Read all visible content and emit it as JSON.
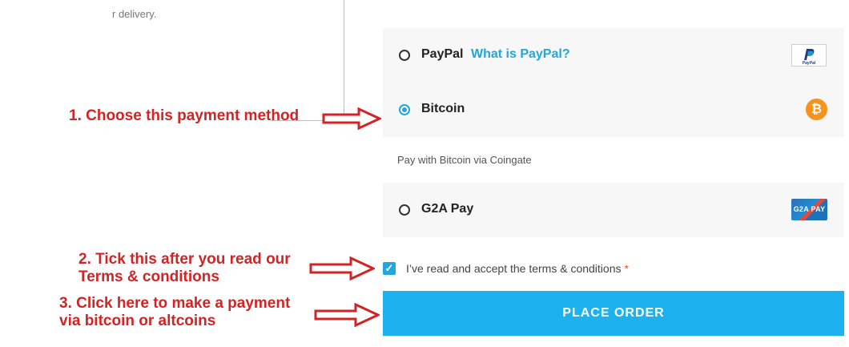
{
  "left_text": "r delivery.",
  "payment_methods": [
    {
      "label": "PayPal",
      "link": "What is PayPal?",
      "logo_text": "PayPal",
      "selected": false
    },
    {
      "label": "Bitcoin",
      "logo_text": "₿",
      "selected": true
    },
    {
      "label": "G2A Pay",
      "logo_text": "G2A PAY",
      "selected": false
    }
  ],
  "bitcoin_description": "Pay with Bitcoin via Coingate",
  "terms": {
    "text": "I’ve read and accept the terms & conditions",
    "required_mark": "*",
    "checked": true
  },
  "place_order_label": "PLACE ORDER",
  "annotations": {
    "step1": "1. Choose this payment method",
    "step2_line1": "2. Tick this after you read our",
    "step2_line2": "Terms & conditions",
    "step3_line1": "3. Click here to make a payment",
    "step3_line2": "via bitcoin or altcoins"
  },
  "colors": {
    "accent": "#1db1ee",
    "annotation": "#d22424",
    "bitcoin": "#f7931a"
  },
  "icons": {
    "paypal": "paypal-logo-icon",
    "bitcoin": "bitcoin-icon",
    "g2a": "g2a-pay-icon",
    "checkbox": "check-icon",
    "arrow": "right-arrow-icon"
  }
}
